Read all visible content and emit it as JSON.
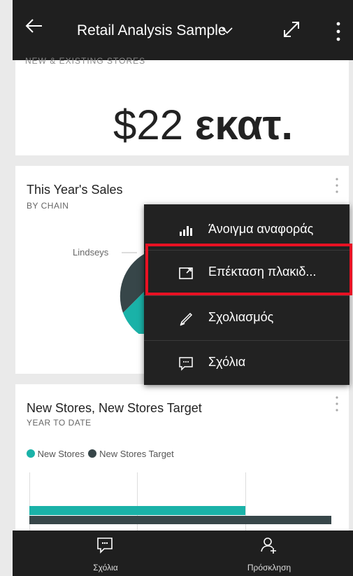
{
  "header": {
    "title": "Retail Analysis Sample",
    "back_icon": "back-arrow-icon",
    "dropdown_icon": "chevron-down-icon",
    "expand_icon": "expand-icon",
    "more_icon": "more-vertical-icon"
  },
  "cards": {
    "new_existing": {
      "subtitle": "NEW & EXISTING STORES",
      "value": "$22",
      "unit": "εκατ."
    },
    "sales": {
      "title": "This Year's Sales",
      "subtitle": "BY CHAIN",
      "pie_label": "Lindseys"
    },
    "new_stores": {
      "title": "New Stores, New Stores Target",
      "subtitle": "YEAR TO DATE",
      "legend": [
        {
          "name": "New Stores",
          "color": "#1ab2a8"
        },
        {
          "name": "New Stores Target",
          "color": "#374649"
        }
      ]
    }
  },
  "chart_data": {
    "type": "bar",
    "series": [
      {
        "name": "New Stores",
        "values": [
          10
        ]
      },
      {
        "name": "New Stores Target",
        "values": [
          14
        ]
      }
    ],
    "categories": [
      ""
    ]
  },
  "menu": {
    "items": [
      {
        "label": "Άνοιγμα αναφοράς",
        "icon": "report-icon"
      },
      {
        "label": "Επέκταση πλακιδ...",
        "icon": "expand-tile-icon"
      },
      {
        "label": "Σχολιασμός",
        "icon": "annotate-pen-icon"
      },
      {
        "label": "Σχόλια",
        "icon": "comment-icon"
      }
    ]
  },
  "bottom": {
    "comments_label": "Σχόλια",
    "invite_label": "Πρόσκληση"
  },
  "colors": {
    "accent_teal": "#1ab2a8",
    "dark_slate": "#374649",
    "highlight_red": "#e81123"
  }
}
